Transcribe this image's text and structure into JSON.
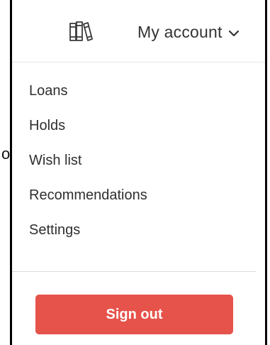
{
  "header": {
    "logo_icon": "books-icon",
    "account_label": "My account",
    "account_chevron_icon": "chevron-down-icon"
  },
  "menu": {
    "items": [
      {
        "label": "Loans"
      },
      {
        "label": "Holds"
      },
      {
        "label": "Wish list"
      },
      {
        "label": "Recommendations"
      },
      {
        "label": "Settings"
      }
    ]
  },
  "footer": {
    "sign_out_label": "Sign out"
  },
  "partial_text": "o",
  "colors": {
    "accent": "#e5534b",
    "text": "#333333",
    "divider": "#dcdcdc",
    "border": "#000000"
  }
}
